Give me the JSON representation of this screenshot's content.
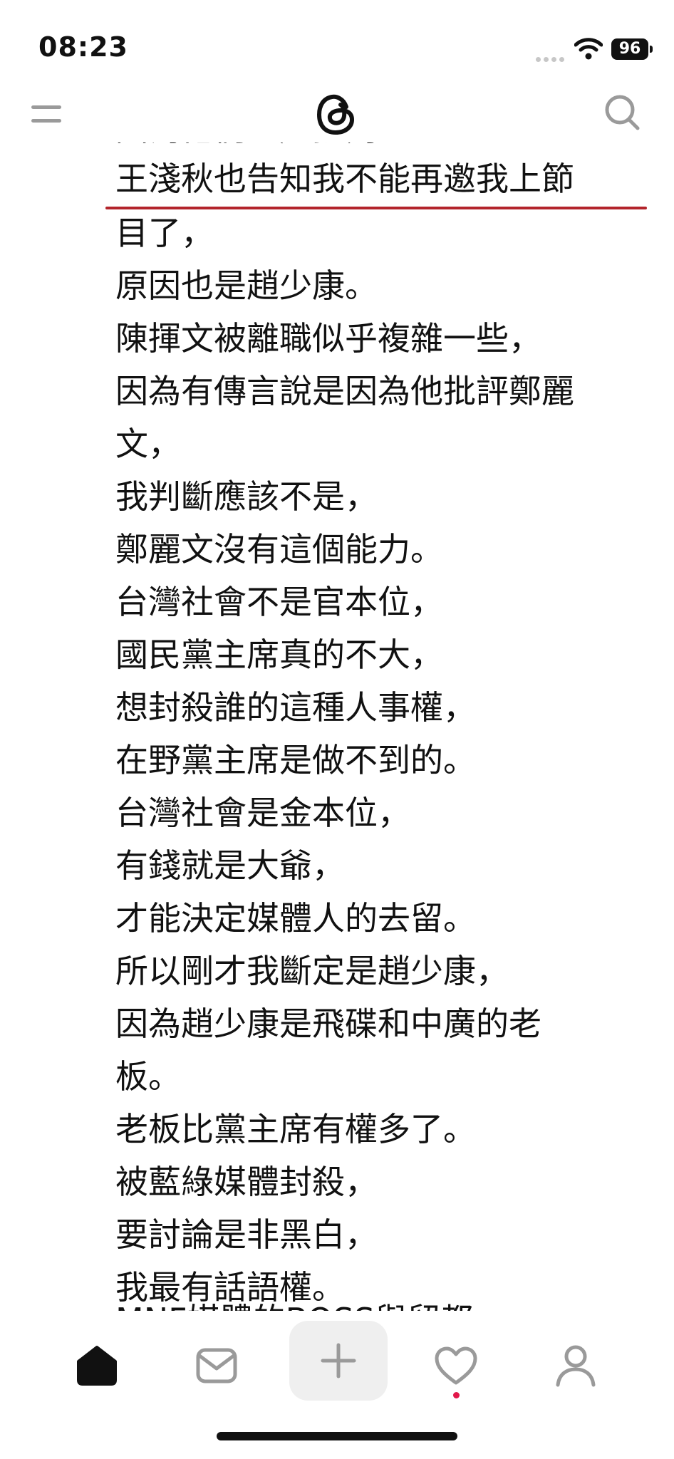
{
  "status_bar": {
    "time": "08:23",
    "battery": "96",
    "icons": [
      "signal-dots-icon",
      "wifi-icon",
      "battery-icon"
    ]
  },
  "top_nav": {
    "icons": [
      "menu-icon",
      "threads-logo-icon",
      "search-icon"
    ]
  },
  "post": {
    "lines": [
      "因為他們一起批判",
      "王淺秋也告知我不能再邀我上節",
      "目了，",
      "原因也是趙少康。",
      "陳揮文被離職似乎複雜一些，",
      "因為有傳言說是因為他批評鄭麗",
      "文，",
      "我判斷應該不是，",
      "鄭麗文沒有這個能力。",
      "台灣社會不是官本位，",
      "國民黨主席真的不大，",
      "想封殺誰的這種人事權，",
      "在野黨主席是做不到的。",
      "台灣社會是金本位，",
      "有錢就是大爺，",
      "才能決定媒體人的去留。",
      "所以剛才我斷定是趙少康，",
      "因為趙少康是飛碟和中廣的老",
      "板。",
      "老板比黨主席有權多了。",
      "被藍綠媒體封殺，",
      "要討論是非黑白，",
      "我最有話語權。",
      "MNF媒體的BOSS與留都"
    ],
    "highlight_color": "#b3242b"
  },
  "bottom_nav": {
    "tabs": [
      "home-icon",
      "inbox-icon",
      "compose-icon",
      "activity-heart-icon",
      "profile-icon"
    ],
    "notification_dot_color": "#e2184a"
  }
}
